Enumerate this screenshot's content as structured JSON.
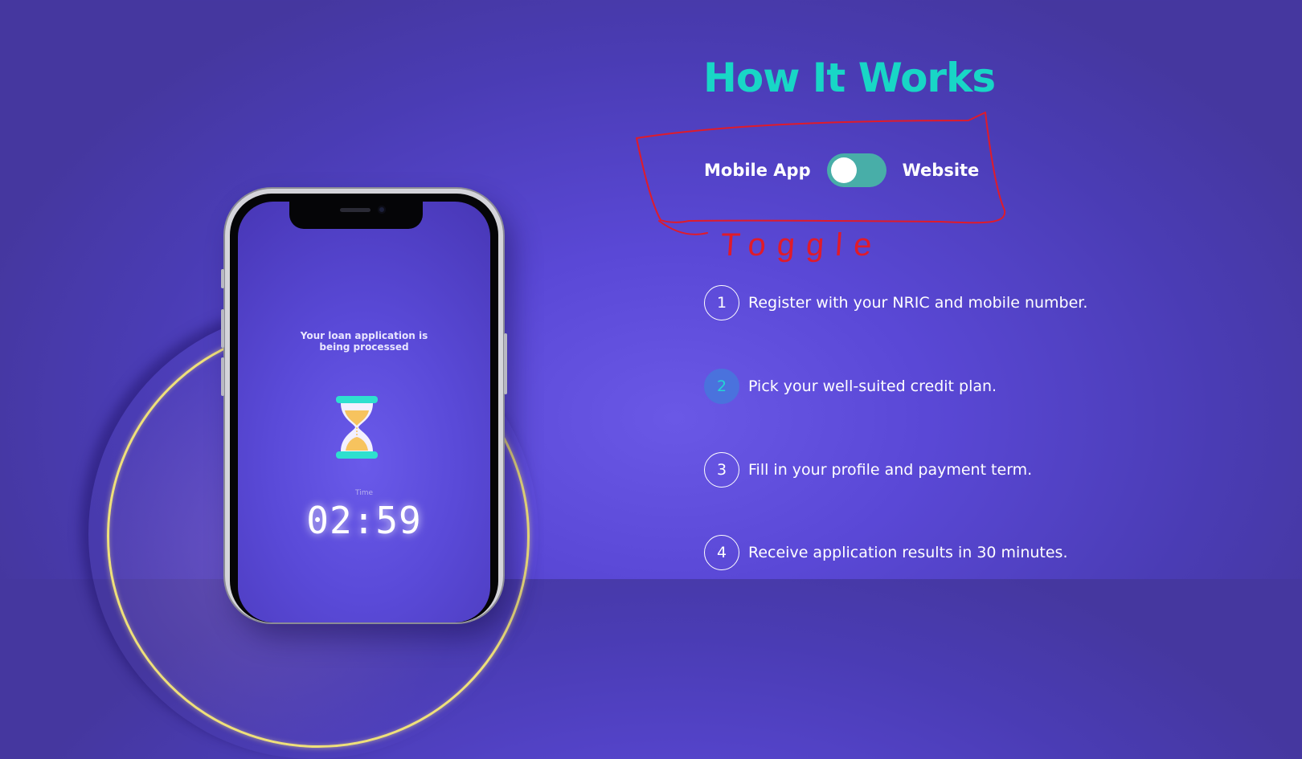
{
  "section": {
    "title": "How It Works"
  },
  "toggle": {
    "left_label": "Mobile App",
    "right_label": "Website",
    "state": "Mobile App",
    "track_color": "#48aea8"
  },
  "annotation": {
    "text": "Toggle",
    "color": "#e01b2a"
  },
  "steps": [
    {
      "number": "1",
      "text": "Register with your NRIC and mobile number.",
      "active": false
    },
    {
      "number": "2",
      "text": "Pick your well-suited credit plan.",
      "active": true
    },
    {
      "number": "3",
      "text": "Fill in your profile and payment term.",
      "active": false
    },
    {
      "number": "4",
      "text": "Receive application results in 30 minutes.",
      "active": false
    }
  ],
  "phone": {
    "message": "Your loan application is being processed",
    "icon": "hourglass-icon",
    "time_label": "Time",
    "timer": "02:59"
  },
  "colors": {
    "accent": "#18d6c6",
    "background": "#5a48d6",
    "active_step": "#4a72dd",
    "ring": "#efe07a"
  }
}
